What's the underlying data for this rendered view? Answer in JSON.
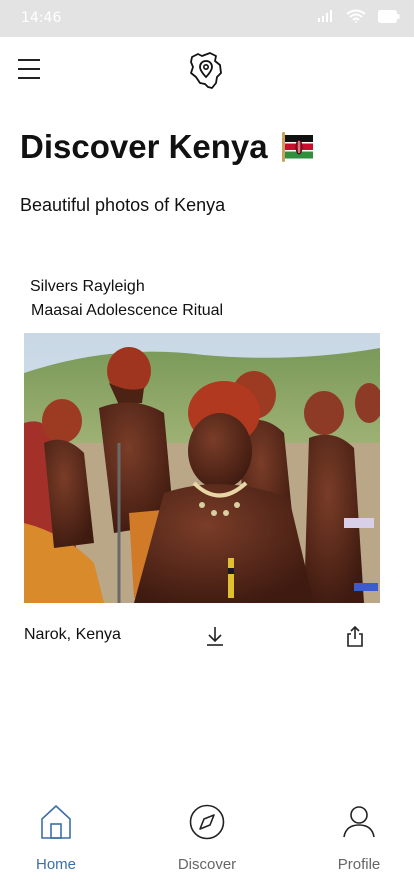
{
  "status_bar": {
    "time": "14:46",
    "icons": [
      "signal-icon",
      "wifi-icon",
      "battery-icon"
    ]
  },
  "header": {
    "menu_icon": "hamburger-menu-icon",
    "logo_icon": "kenya-map-pin-logo"
  },
  "page": {
    "title": "Discover Kenya",
    "title_emoji_icon": "kenya-flag-icon",
    "subtitle": "Beautiful photos of Kenya"
  },
  "card": {
    "author": "Silvers Rayleigh",
    "caption": "Maasai Adolescence Ritual",
    "photo_icon": "maasai-photo",
    "location": "Narok, Kenya",
    "actions": [
      "download-icon",
      "share-icon"
    ]
  },
  "tabbar": {
    "tabs": [
      {
        "label": "Home",
        "icon": "home-icon",
        "active": true
      },
      {
        "label": "Discover",
        "icon": "compass-icon",
        "active": false
      },
      {
        "label": "Profile",
        "icon": "user-icon",
        "active": false
      }
    ]
  },
  "colors": {
    "status_bar_bg": "#e3e3e3",
    "active_tab": "#3c6fa6",
    "inactive_tab": "#666666",
    "text": "#111111"
  }
}
